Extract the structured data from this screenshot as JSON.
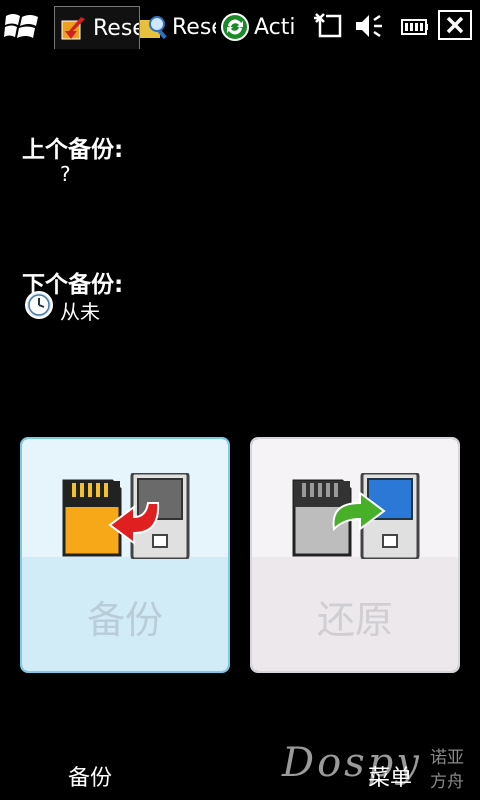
{
  "taskbar": {
    "tabs": [
      {
        "label": "Rese",
        "active": true
      },
      {
        "label": "Rese",
        "active": false
      },
      {
        "label": "Acti",
        "active": false
      }
    ]
  },
  "backup_info": {
    "last_label": "上个备份:",
    "last_value": "?",
    "next_label": "下个备份:",
    "next_value": "从未"
  },
  "tiles": {
    "backup_label": "备份",
    "restore_label": "还原"
  },
  "softkeys": {
    "left": "备份",
    "right": "菜单"
  },
  "watermark": {
    "brand": "Dospy",
    "cn_line1": "诺亚",
    "cn_line2": "方舟"
  },
  "colors": {
    "background": "#000000",
    "backup_tile": "#e6f5fc",
    "restore_tile": "#f6f3f7"
  }
}
